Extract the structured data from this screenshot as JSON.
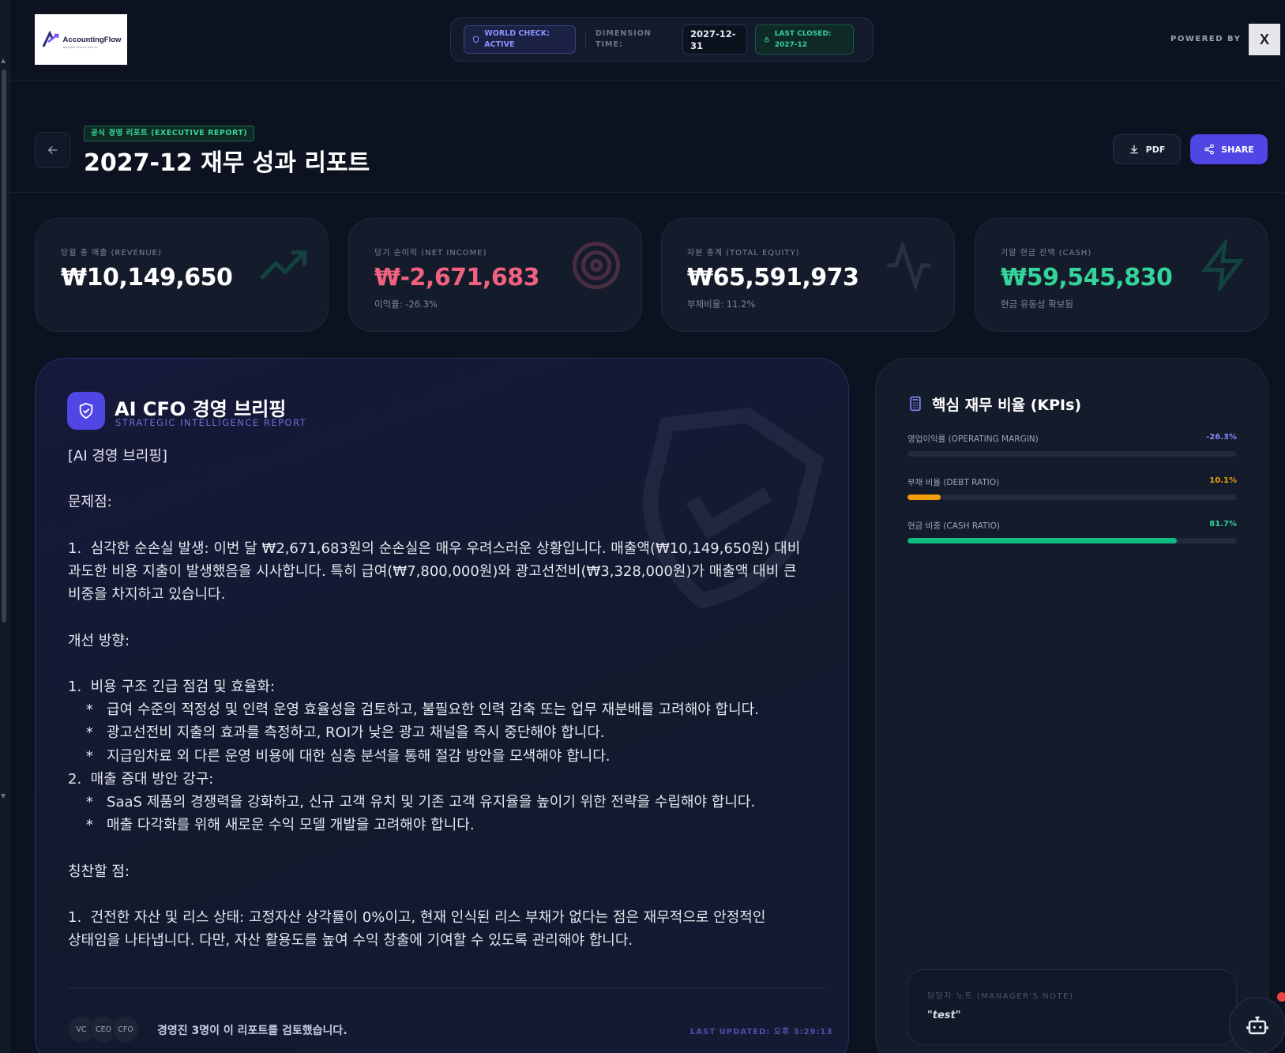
{
  "topbar": {
    "logo_text": "AccountingFlow",
    "logo_sub": "Navigate Finance with AI",
    "world_check": "WORLD CHECK: ACTIVE",
    "dimension_label": "DIMENSION TIME:",
    "dimension_value": "2027-12-31",
    "last_closed": "LAST CLOSED: 2027-12",
    "powered_by": "POWERED BY"
  },
  "header": {
    "badge": "공식 경영 리포트 (EXECUTIVE REPORT)",
    "title": "2027-12 재무 성과 리포트",
    "pdf_label": "PDF",
    "share_label": "SHARE"
  },
  "kpis": [
    {
      "label": "당월 총 매출 (REVENUE)",
      "value": "₩10,149,650",
      "sub": "",
      "icon": "trending-up-icon",
      "tone": "neutral"
    },
    {
      "label": "당기 순이익 (NET INCOME)",
      "value": "₩-2,671,683",
      "sub": "이익률: -26.3%",
      "icon": "target-icon",
      "tone": "negative"
    },
    {
      "label": "자본 총계 (TOTAL EQUITY)",
      "value": "₩65,591,973",
      "sub": "부채비율: 11.2%",
      "icon": "activity-icon",
      "tone": "neutral"
    },
    {
      "label": "기말 현금 잔액 (CASH)",
      "value": "₩59,545,830",
      "sub": "현금 유동성 확보됨",
      "icon": "zap-icon",
      "tone": "positive"
    }
  ],
  "briefing": {
    "title": "AI CFO 경영 브리핑",
    "subtitle": "STRATEGIC INTELLIGENCE REPORT",
    "body": "[AI 경영 브리핑]\n\n문제점:\n\n1.  심각한 순손실 발생: 이번 달 ₩2,671,683원의 순손실은 매우 우려스러운 상황입니다. 매출액(₩10,149,650원) 대비\n과도한 비용 지출이 발생했음을 시사합니다. 특히 급여(₩7,800,000원)와 광고선전비(₩3,328,000원)가 매출액 대비 큰\n비중을 차지하고 있습니다.\n\n개선 방향:\n\n1.  비용 구조 긴급 점검 및 효율화:\n    *   급여 수준의 적정성 및 인력 운영 효율성을 검토하고, 불필요한 인력 감축 또는 업무 재분배를 고려해야 합니다.\n    *   광고선전비 지출의 효과를 측정하고, ROI가 낮은 광고 채널을 즉시 중단해야 합니다.\n    *   지급임차료 외 다른 운영 비용에 대한 심층 분석을 통해 절감 방안을 모색해야 합니다.\n2.  매출 증대 방안 강구:\n    *   SaaS 제품의 경쟁력을 강화하고, 신규 고객 유치 및 기존 고객 유지율을 높이기 위한 전략을 수립해야 합니다.\n    *   매출 다각화를 위해 새로운 수익 모델 개발을 고려해야 합니다.\n\n칭찬할 점:\n\n1.  건전한 자산 및 리스 상태: 고정자산 상각률이 0%이고, 현재 인식된 리스 부채가 없다는 점은 재무적으로 안정적인\n상태임을 나타냅니다. 다만, 자산 활용도를 높여 수익 창출에 기여할 수 있도록 관리해야 합니다.",
    "avatars": [
      "VC",
      "CEO",
      "CFO"
    ],
    "reviewed": "경영진 3명이 이 리포트를 검토했습니다.",
    "updated": "LAST UPDATED: 오후 3:29:13"
  },
  "ratios": {
    "title": "핵심 재무 비율 (KPIs)",
    "items": [
      {
        "label": "영업이익률 (OPERATING MARGIN)",
        "value": "-26.3%",
        "fill": 0,
        "color": "#818cf8"
      },
      {
        "label": "부채 비율 (DEBT RATIO)",
        "value": "10.1%",
        "fill": 0.101,
        "color": "#f59e0b"
      },
      {
        "label": "현금 비중 (CASH RATIO)",
        "value": "81.7%",
        "fill": 0.817,
        "color": "#10b981"
      }
    ],
    "note_label": "담당자 노트 (MANAGER'S NOTE)",
    "note_value": "\"test\""
  }
}
